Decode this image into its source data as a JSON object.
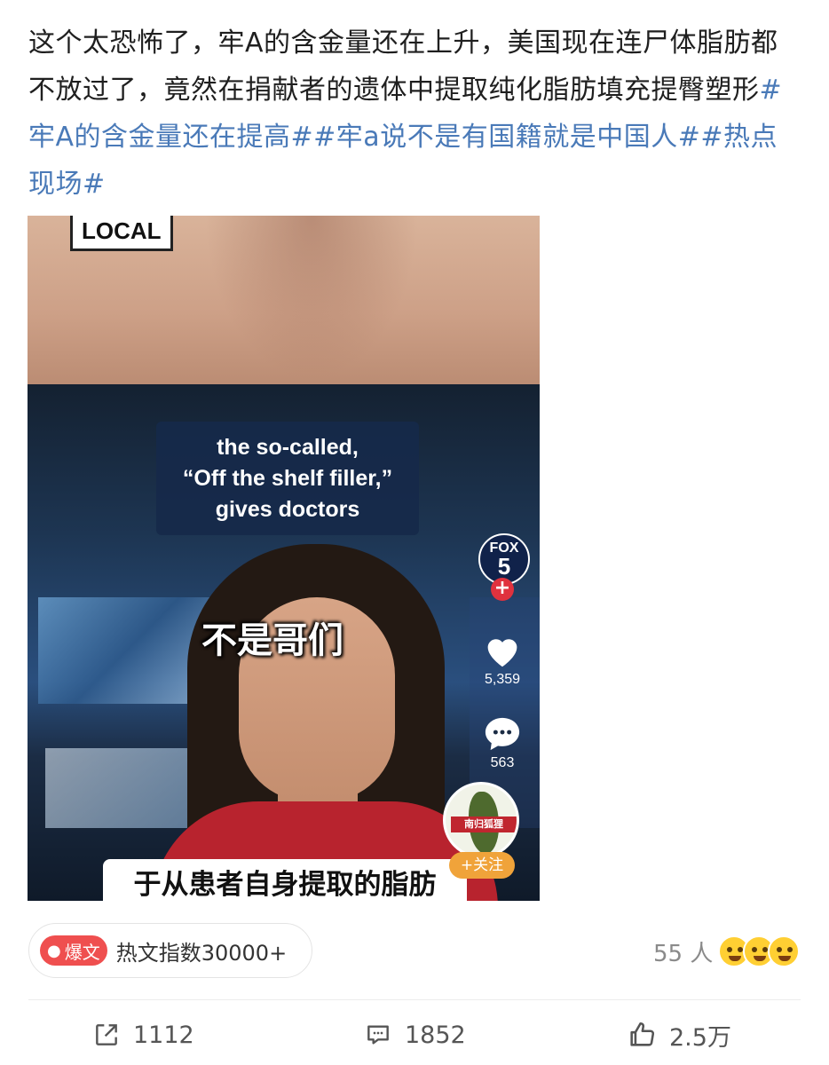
{
  "post": {
    "text_plain": "这个太恐怖了，牢A的含金量还在上升，美国现在连尸体脂肪都不放过了，竟然在捐献者的遗体中提取纯化脂肪填充提臀塑形",
    "hashtags": [
      "#牢A的含金量还在提高#",
      "#牢a说不是有国籍就是中国人#",
      "#热点现场#"
    ]
  },
  "video": {
    "local_badge": "LOCAL",
    "caption_lines": [
      "the so-called,",
      "“Off the shelf filler,”",
      "gives doctors"
    ],
    "subtitle_top": "不是哥们",
    "subtitle_bottom": "于从患者自身提取的脂肪",
    "channel_logo_line1": "FOX",
    "channel_logo_line2": "5",
    "likes": "5,359",
    "comments": "563",
    "avatar_stamp": "南归狐狸",
    "follow_label": "+关注"
  },
  "hot": {
    "badge_label": "爆文",
    "index_text": "热文指数30000+"
  },
  "reactions": {
    "count": "55 人"
  },
  "actions": {
    "share_count": "1112",
    "comment_count": "1852",
    "like_count": "2.5万"
  },
  "colors": {
    "hashtag": "#4a7ab8",
    "hot_badge": "#ef4f4f",
    "follow": "#f0a33a"
  }
}
